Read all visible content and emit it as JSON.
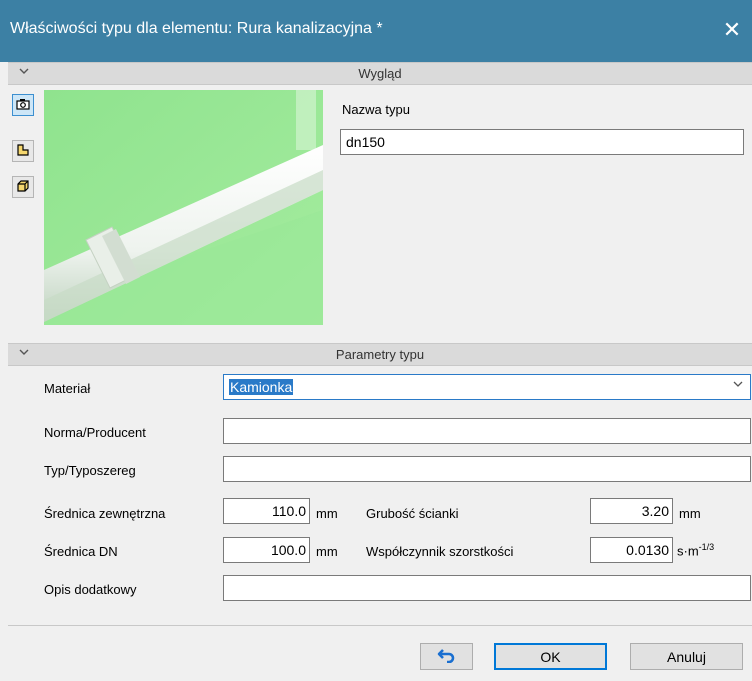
{
  "window": {
    "title": "Właściwości typu dla elementu: Rura kanalizacyjna *",
    "close_glyph": "✕"
  },
  "appearance": {
    "header": "Wygląd",
    "view_buttons": [
      "camera-icon",
      "front-view-icon",
      "3d-view-icon"
    ],
    "type_name_label": "Nazwa typu",
    "type_name_value": "dn150",
    "preview_background": "#9be79a"
  },
  "params": {
    "header": "Parametry typu",
    "material": {
      "label": "Materiał",
      "value": "Kamionka"
    },
    "norm": {
      "label": "Norma/Producent",
      "value": ""
    },
    "series": {
      "label": "Typ/Typoszereg",
      "value": ""
    },
    "outer_diameter": {
      "label": "Średnica zewnętrzna",
      "value": "110.0",
      "unit": "mm"
    },
    "wall_thickness": {
      "label": "Grubość ścianki",
      "value": "3.20",
      "unit": "mm"
    },
    "dn": {
      "label": "Średnica DN",
      "value": "100.0",
      "unit": "mm"
    },
    "roughness": {
      "label": "Współczynnik szorstkości",
      "value": "0.0130",
      "unit_base": "s·m",
      "unit_exp": "-1/3"
    },
    "description": {
      "label": "Opis dodatkowy",
      "value": ""
    }
  },
  "footer": {
    "ok_label": "OK",
    "cancel_label": "Anuluj"
  },
  "colors": {
    "titlebar": "#3c80a4",
    "accent": "#2a7ac8"
  }
}
